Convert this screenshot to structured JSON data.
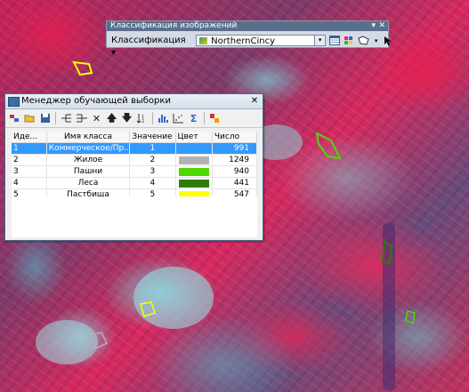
{
  "toolbar": {
    "title": "Классификация изображений",
    "close": "✕",
    "menu_label": "Классификация ▾",
    "layer_name": "NorthernCincy",
    "combo_arrow": "▾"
  },
  "manager": {
    "title": "Менеджер обучающей выборки",
    "close": "✕",
    "columns": {
      "id": "Иде...",
      "class_name": "Имя класса",
      "value": "Значение",
      "color": "Цвет",
      "count": "Число"
    },
    "rows": [
      {
        "id": "1",
        "class_name": "Коммерческое/Пр...",
        "value": "1",
        "color": "#3399ff",
        "count": "991"
      },
      {
        "id": "2",
        "class_name": "Жилое",
        "value": "2",
        "color": "#b2b2b2",
        "count": "1249"
      },
      {
        "id": "3",
        "class_name": "Пашни",
        "value": "3",
        "color": "#4cd900",
        "count": "940"
      },
      {
        "id": "4",
        "class_name": "Леса",
        "value": "4",
        "color": "#2e7d0a",
        "count": "441"
      },
      {
        "id": "5",
        "class_name": "Пастбища",
        "value": "5",
        "color": "#ffff00",
        "count": "547"
      }
    ],
    "tool_icons": [
      "merge-icon",
      "open-icon",
      "save-icon",
      "split-icon",
      "merge-classes-icon",
      "delete-icon",
      "move-up-icon",
      "move-down-icon",
      "sort-icon",
      "histogram-icon",
      "scatterplot-icon",
      "statistics-icon",
      "signature-icon"
    ]
  },
  "colors": {
    "selection": "#3399ff",
    "title_bar": "#5a6f8c"
  }
}
